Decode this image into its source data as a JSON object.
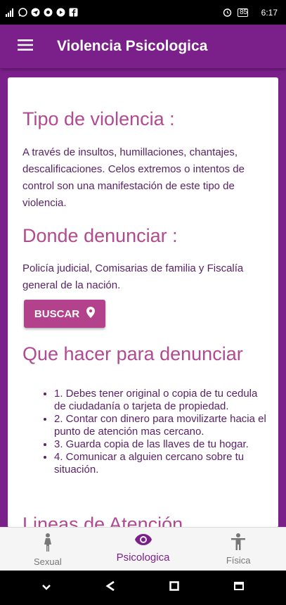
{
  "status_bar": {
    "left_icons": [
      "signal-icon",
      "whatsapp-icon",
      "telegram-icon",
      "notification-icon",
      "youtube-icon",
      "facebook-icon"
    ],
    "right_icons": [
      "alarm-icon",
      "battery-icon"
    ],
    "battery": "85",
    "time": "6:17"
  },
  "app_bar": {
    "title": "Violencia Psicologica"
  },
  "content": {
    "section1_title": "Tipo de violencia :",
    "section1_text": "A través de insultos, humillaciones, chantajes, descalificaciones. Celos extremos o intentos de control son una manifestación de este tipo de violencia.",
    "section2_title": "Donde denunciar :",
    "section2_text": "Policía judicial, Comisarias de familia y Fiscalía general de la nación.",
    "buscar_label": "BUSCAR",
    "section3_title": "Que hacer para denunciar",
    "steps": [
      "1. Debes tener original o copia de tu cedula de ciudadanía o tarjeta de propiedad.",
      "2. Contar con dinero para movilizarte hacia el punto de atención mas cercano.",
      "3. Guarda copia de las llaves de tu hogar.",
      "4. Comunicar a alguien cercano sobre tu situación."
    ],
    "section4_title": "Lineas de Atención"
  },
  "bottom_nav": {
    "items": [
      {
        "label": "Sexual",
        "icon": "person-female-icon",
        "active": false
      },
      {
        "label": "Psicologica",
        "icon": "eye-icon",
        "active": true
      },
      {
        "label": "Física",
        "icon": "person-arms-icon",
        "active": false
      }
    ]
  },
  "system_nav": {
    "items": [
      "chevron-down-icon",
      "back-icon",
      "home-icon",
      "recents-icon"
    ]
  },
  "colors": {
    "primary": "#7b1f8a",
    "accent": "#b3418c",
    "title": "#b14a91",
    "text": "#5a2266"
  }
}
